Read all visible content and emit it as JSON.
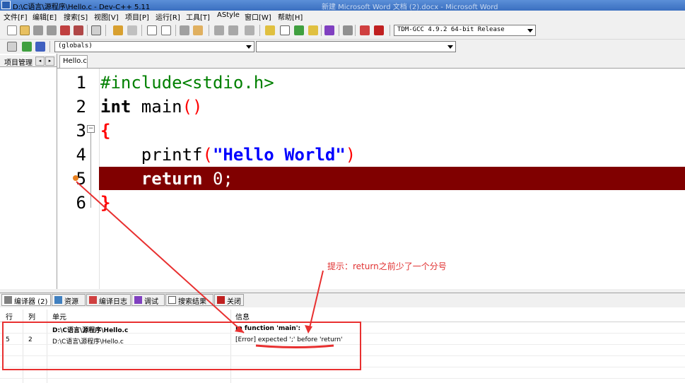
{
  "window": {
    "title": "D:\\C语言\\源程序\\Hello.c - Dev-C++ 5.11",
    "ghost_title": "新建 Microsoft Word 文档 (2).docx - Microsoft Word"
  },
  "menu": [
    "文件[F]",
    "编辑[E]",
    "搜索[S]",
    "视图[V]",
    "项目[P]",
    "运行[R]",
    "工具[T]",
    "AStyle",
    "窗口[W]",
    "帮助[H]"
  ],
  "toolbar": {
    "compiler_select": "TDM-GCC 4.9.2 64-bit Release",
    "scope_select": "(globals)",
    "member_select": ""
  },
  "left_panel": {
    "tab_label": "项目管理"
  },
  "editor": {
    "tab_label": "Hello.c",
    "line_numbers": [
      "1",
      "2",
      "3",
      "4",
      "5",
      "6"
    ],
    "fold_marker": "⊟",
    "lines": {
      "l1": "#include<stdio.h>",
      "l2_kw": "int",
      "l2_name": " main",
      "l2_paren": "()",
      "l3": "{",
      "l4_fn": "    printf",
      "l4_open": "(",
      "l4_str": "\"Hello World\"",
      "l4_close": ")",
      "l5_kw": "    return",
      "l5_num": " 0",
      "l5_semi": ";",
      "l6": "}"
    },
    "error_line_color": "#800000"
  },
  "annotation": {
    "hint": "提示：return之前少了一个分号",
    "color": "#e03030"
  },
  "bottom_tabs": [
    "编译器 (2)",
    "资源",
    "编译日志",
    "调试",
    "搜索结果",
    "关闭"
  ],
  "messages": {
    "headers": [
      "行",
      "列",
      "单元",
      "信息"
    ],
    "rows": [
      {
        "line": "",
        "col": "",
        "unit": "D:\\C语言\\源程序\\Hello.c",
        "info": "In function 'main':"
      },
      {
        "line": "5",
        "col": "2",
        "unit": "D:\\C语言\\源程序\\Hello.c",
        "info": "[Error] expected ';' before 'return'"
      }
    ]
  }
}
